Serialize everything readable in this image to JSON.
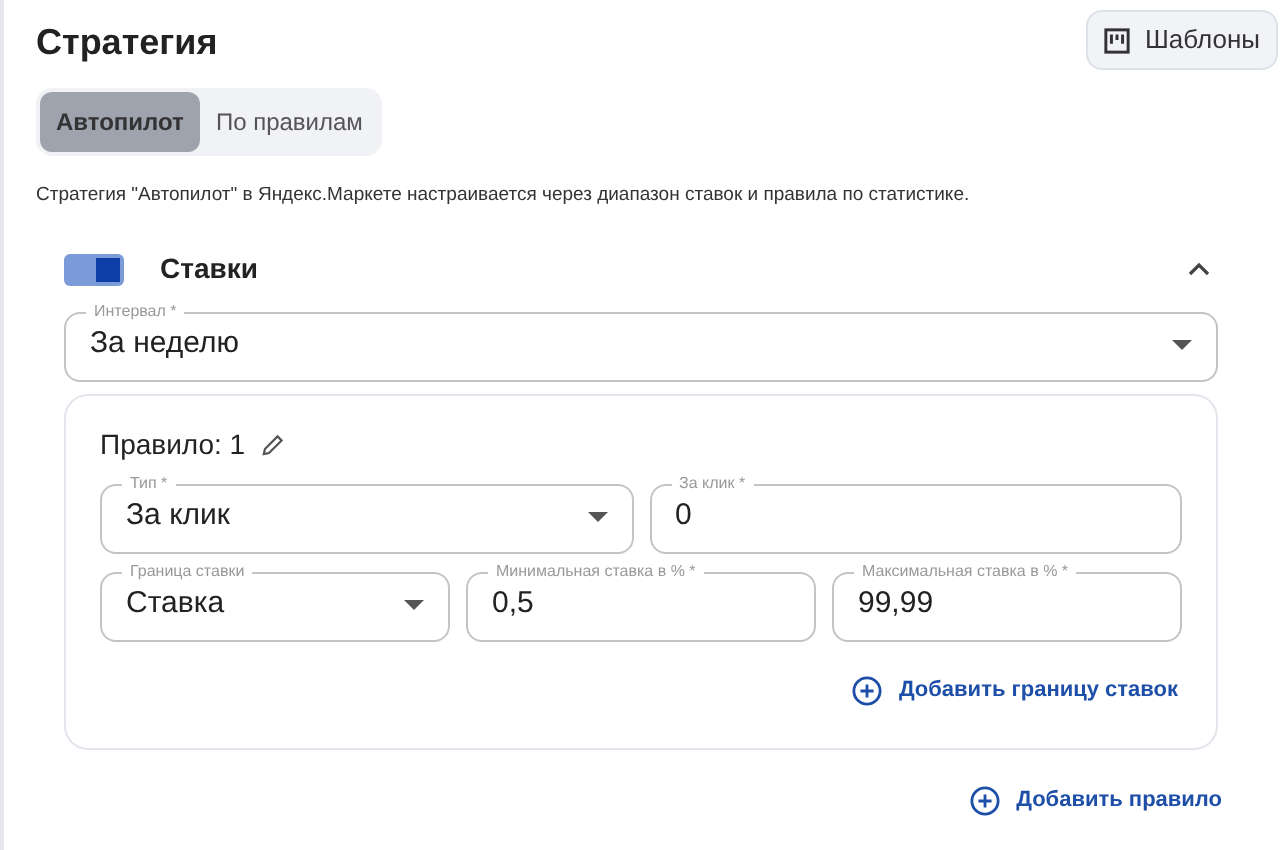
{
  "title": "Стратегия",
  "templates_button": "Шаблоны",
  "tabs": [
    {
      "label": "Автопилот",
      "selected": true
    },
    {
      "label": "По правилам",
      "selected": false
    }
  ],
  "description": "Стратегия \"Автопилот\" в Яндекс.Маркете настраивается через диапазон ставок и правила по статистике.",
  "section": {
    "title": "Ставки",
    "enabled": true,
    "expanded": true
  },
  "interval": {
    "kind": "select",
    "label": "Интервал *",
    "value": "За неделю"
  },
  "rule": {
    "title": "Правило: 1",
    "rows": [
      [
        {
          "kind": "select",
          "label": "Тип *",
          "value": "За клик"
        },
        {
          "kind": "input",
          "label": "За клик *",
          "value": "0"
        }
      ],
      [
        {
          "kind": "select",
          "label": "Граница ставки",
          "value": "Ставка"
        },
        {
          "kind": "input",
          "label": "Минимальная ставка в % *",
          "value": "0,5"
        },
        {
          "kind": "input",
          "label": "Максимальная ставка в % *",
          "value": "99,99"
        }
      ]
    ],
    "add_bound": "Добавить границу ставок"
  },
  "add_rule": "Добавить правило"
}
